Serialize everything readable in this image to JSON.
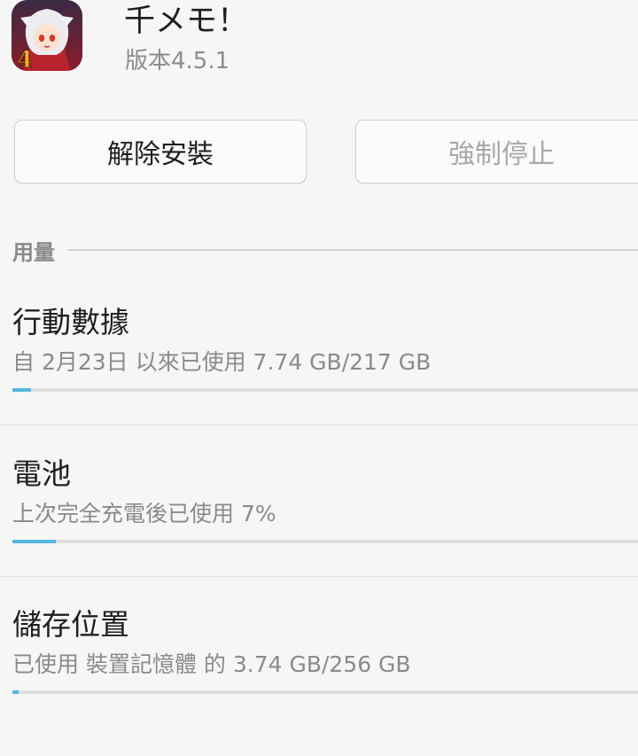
{
  "app": {
    "name": "千メモ！",
    "version": "版本4.5.1",
    "icon": "app-anime-character-icon"
  },
  "buttons": {
    "uninstall": "解除安裝",
    "force_stop": "強制停止"
  },
  "usage": {
    "section_label": "用量",
    "items": [
      {
        "title": "行動數據",
        "subtitle": "自 2月23日 以來已使用 7.74 GB/217 GB",
        "percent": 3
      },
      {
        "title": "電池",
        "subtitle": "上次完全充電後已使用 7%",
        "percent": 7
      },
      {
        "title": "儲存位置",
        "subtitle": "已使用 裝置記憶體 的 3.74 GB/256 GB",
        "percent": 1
      }
    ]
  },
  "colors": {
    "accent": "#55b6e2",
    "disabled_text": "#a8a8a8"
  }
}
